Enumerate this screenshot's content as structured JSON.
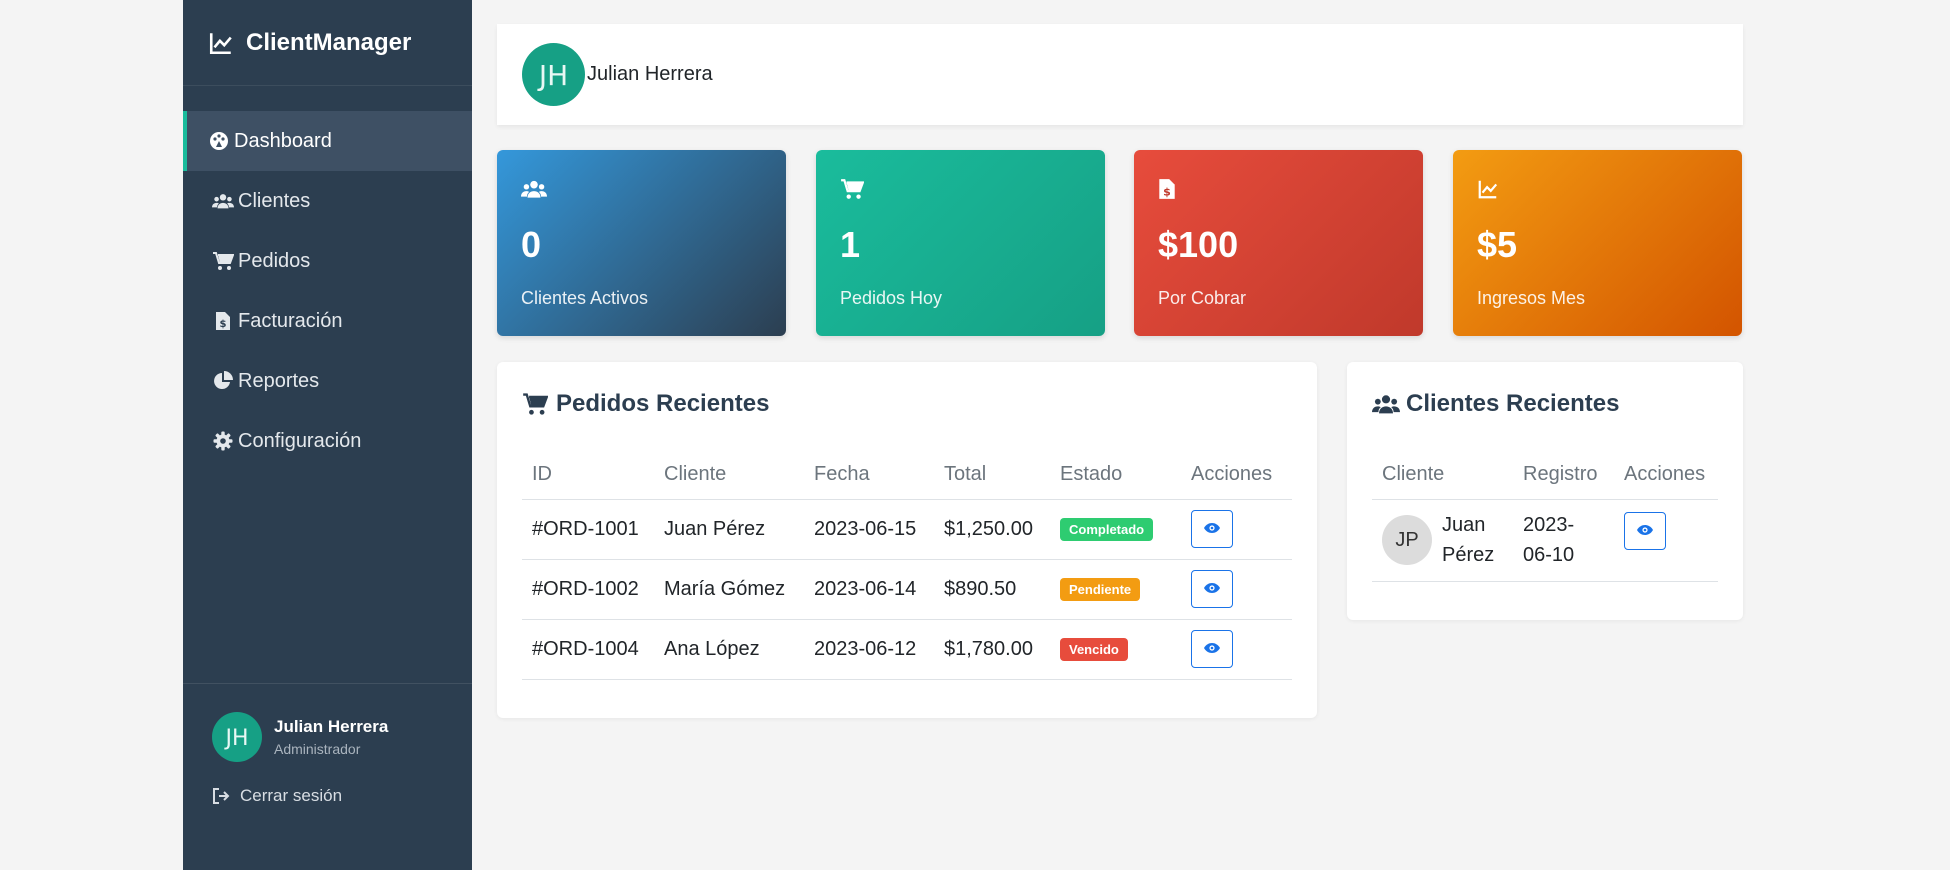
{
  "app": {
    "brand": "ClientManager"
  },
  "sidebar": {
    "items": [
      {
        "label": "Dashboard",
        "icon": "palette-icon",
        "active": true
      },
      {
        "label": "Clientes",
        "icon": "users-icon"
      },
      {
        "label": "Pedidos",
        "icon": "cart-icon"
      },
      {
        "label": "Facturación",
        "icon": "invoice-icon"
      },
      {
        "label": "Reportes",
        "icon": "pie-chart-icon"
      },
      {
        "label": "Configuración",
        "icon": "gear-icon"
      }
    ],
    "user": {
      "name": "Julian Herrera",
      "role": "Administrador",
      "initials": "JH"
    },
    "logout_label": "Cerrar sesión"
  },
  "header": {
    "user_name": "Julian Herrera",
    "avatar_initials": "JH"
  },
  "stats": [
    {
      "value": "0",
      "label": "Clientes Activos",
      "icon": "users-icon",
      "color": "#3498db"
    },
    {
      "value": "1",
      "label": "Pedidos Hoy",
      "icon": "cart-icon",
      "color": "#1abc9c"
    },
    {
      "value": "$100",
      "label": "Por Cobrar",
      "icon": "invoice-icon",
      "color": "#e74c3c"
    },
    {
      "value": "$5",
      "label": "Ingresos Mes",
      "icon": "line-chart-icon",
      "color": "#f39c12"
    }
  ],
  "orders": {
    "title": "Pedidos Recientes",
    "columns": [
      "ID",
      "Cliente",
      "Fecha",
      "Total",
      "Estado",
      "Acciones"
    ],
    "rows": [
      {
        "id": "#ORD-1001",
        "cliente": "Juan Pérez",
        "fecha": "2023-06-15",
        "total": "$1,250.00",
        "estado": "Completado",
        "estado_color": "#2ecc71"
      },
      {
        "id": "#ORD-1002",
        "cliente": "María Gómez",
        "fecha": "2023-06-14",
        "total": "$890.50",
        "estado": "Pendiente",
        "estado_color": "#f39c12"
      },
      {
        "id": "#ORD-1004",
        "cliente": "Ana López",
        "fecha": "2023-06-12",
        "total": "$1,780.00",
        "estado": "Vencido",
        "estado_color": "#e74c3c"
      }
    ]
  },
  "clients": {
    "title": "Clientes Recientes",
    "columns": [
      "Cliente",
      "Registro",
      "Acciones"
    ],
    "rows": [
      {
        "initials": "JP",
        "name": "Juan Pérez",
        "registro": "2023-06-10"
      }
    ]
  }
}
